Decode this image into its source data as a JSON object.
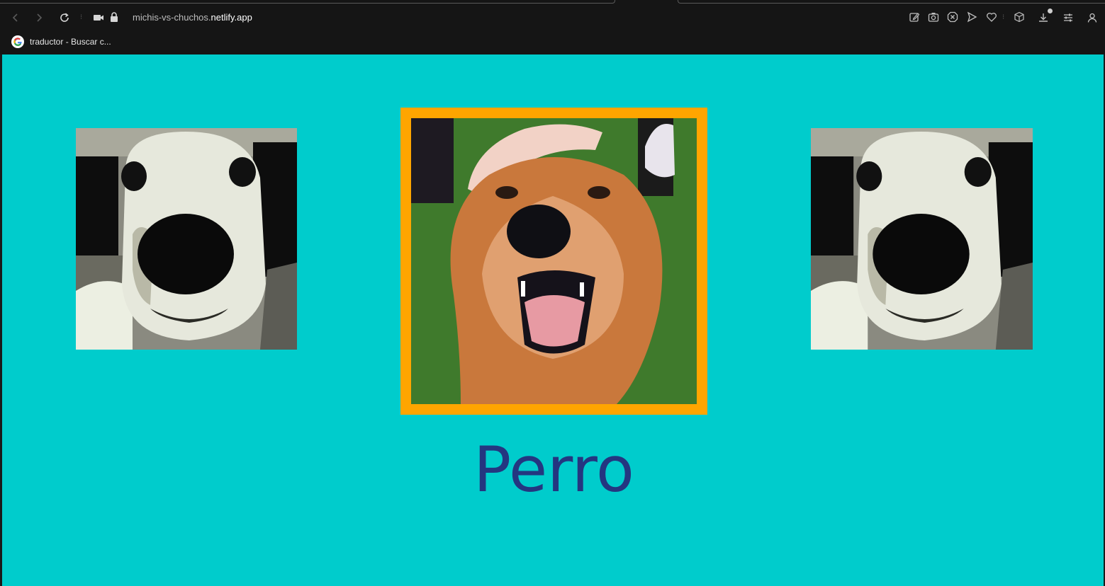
{
  "browser": {
    "url_subdomain": "michis-vs-chuchos.",
    "url_domain": "netlify.app",
    "bookmark_label": "traductor - Buscar c...",
    "icons": [
      "back-icon",
      "forward-icon",
      "reload-icon",
      "camera-icon",
      "lock-icon",
      "edit-icon",
      "screenshot-icon",
      "adblock-icon",
      "send-icon",
      "heart-icon",
      "box-icon",
      "download-icon",
      "settings-icon",
      "profile-icon"
    ]
  },
  "page": {
    "background_color": "#00CCCC",
    "frame_color": "#FFA500",
    "title_color": "#243680",
    "animal_name": "Perro",
    "left_image": "white-dog-meme-image",
    "center_image": "golden-retriever-image",
    "right_image": "white-dog-meme-image"
  }
}
